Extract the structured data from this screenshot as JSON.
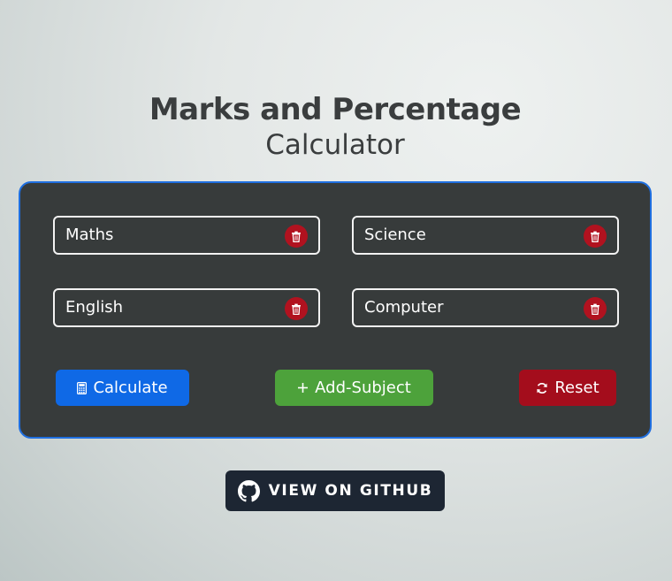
{
  "header": {
    "title_line1": "Marks and Percentage",
    "title_line2": "Calculator"
  },
  "subjects": [
    {
      "name": "Maths",
      "delete_icon": "trash-icon"
    },
    {
      "name": "Science",
      "delete_icon": "trash-icon"
    },
    {
      "name": "English",
      "delete_icon": "trash-icon"
    },
    {
      "name": "Computer",
      "delete_icon": "trash-icon"
    }
  ],
  "actions": {
    "calculate": {
      "label": "Calculate",
      "icon": "calculator-icon",
      "color": "#0f69e6"
    },
    "add_subject": {
      "label": "Add-Subject",
      "icon": "plus-icon",
      "color": "#4da23b"
    },
    "reset": {
      "label": "Reset",
      "icon": "refresh-icon",
      "color": "#a40d1c"
    }
  },
  "github_link": {
    "label": "VIEW ON GITHUB",
    "icon": "github-icon"
  },
  "colors": {
    "card_background": "#373b3b",
    "card_border": "#1f6fe0",
    "delete_button": "#b1121f",
    "github_button": "#1d2633"
  }
}
